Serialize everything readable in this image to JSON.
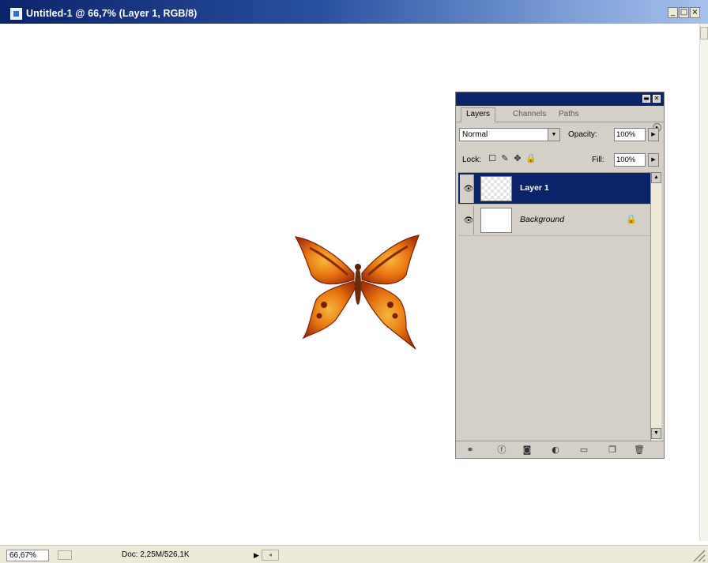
{
  "window": {
    "title": "Untitled-1 @ 66,7% (Layer 1, RGB/8)",
    "minimize": "_",
    "restore": "□",
    "close": "×"
  },
  "status": {
    "zoom": "66,67%",
    "doc_info": "Doc: 2,25M/526,1K",
    "arrow": "▶"
  },
  "layers_panel": {
    "tabs": [
      "Layers",
      "Channels",
      "Paths"
    ],
    "blend_mode": "Normal",
    "opacity_label": "Opacity:",
    "opacity_value": "100%",
    "lock_label": "Lock:",
    "fill_label": "Fill:",
    "fill_value": "100%",
    "layers": [
      {
        "name": "Layer 1",
        "selected": true,
        "visible": true
      },
      {
        "name": "Background",
        "selected": false,
        "visible": true,
        "locked": true
      }
    ],
    "footer_icons": [
      "link-icon",
      "layer-style-icon",
      "mask-icon",
      "adjustment-icon",
      "folder-icon",
      "new-layer-icon",
      "trash-icon"
    ]
  },
  "colors": {
    "title_blue": "#0a246a",
    "panel_gray": "#d4d0c8",
    "butterfly_orange": "#e86a0c"
  }
}
